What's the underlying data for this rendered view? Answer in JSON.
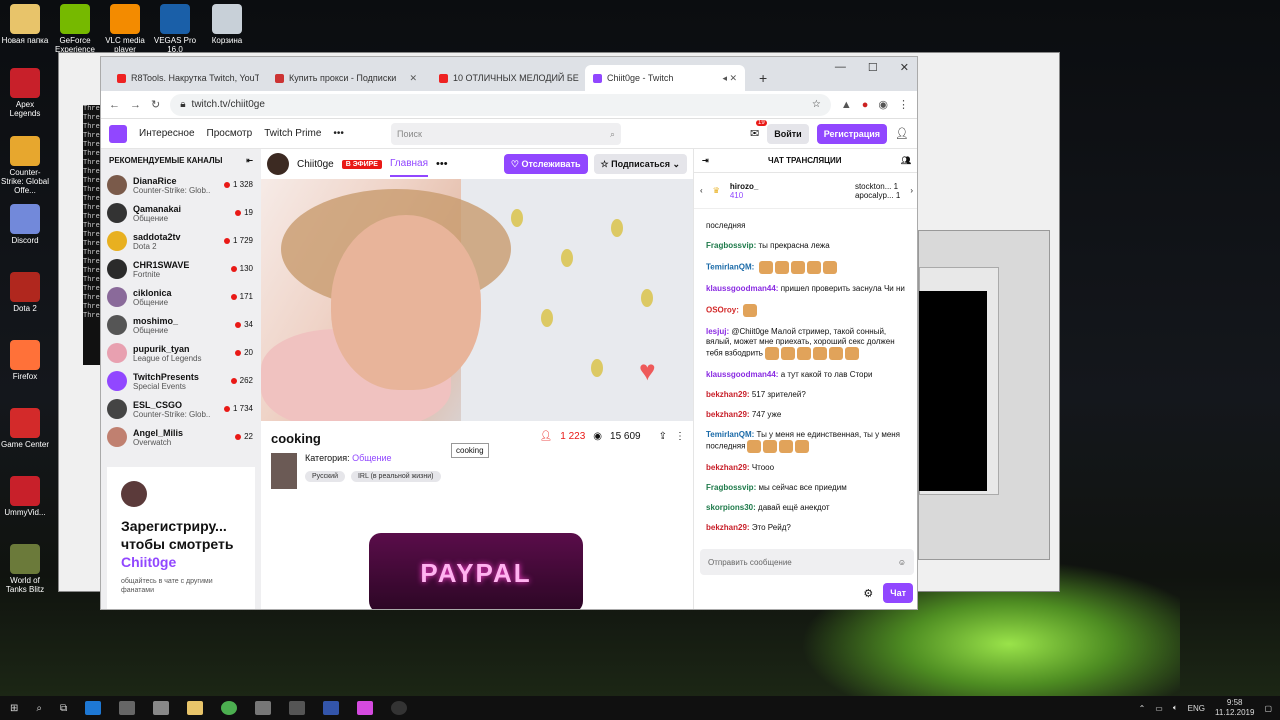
{
  "desktop": {
    "icons": [
      {
        "label": "Новая папка",
        "color": "#e8c46a"
      },
      {
        "label": "GeForce Experience",
        "color": "#76b900"
      },
      {
        "label": "VLC media player",
        "color": "#f38b00"
      },
      {
        "label": "VEGAS Pro 16.0",
        "color": "#1a5fa8"
      },
      {
        "label": "Корзина",
        "color": "#c8d0d8"
      },
      {
        "label": "Apex Legends",
        "color": "#c8202a"
      },
      {
        "label": "Counter-Strike: Global Offe...",
        "color": "#e7a72e"
      },
      {
        "label": "Discord",
        "color": "#7289da"
      },
      {
        "label": "Dota 2",
        "color": "#b0271e"
      },
      {
        "label": "Firefox",
        "color": "#ff7139"
      },
      {
        "label": "Game Center",
        "color": "#d32a2a"
      },
      {
        "label": "UmmyVid...",
        "color": "#c8202a"
      },
      {
        "label": "World of Tanks Blitz",
        "color": "#6b7a3a"
      }
    ],
    "console_lines": [
      "Thre",
      "Thre",
      "Thre",
      "Thre",
      "Thre",
      "Thre",
      "Thre",
      "Thre",
      "Thre",
      "Thre",
      "Thre",
      "Thre",
      "Thre",
      "Thre",
      "Thre",
      "Thre",
      "Thre",
      "Thre",
      "Thre",
      "Thre",
      "Thre",
      "Thre",
      "Thre",
      "Thre"
    ]
  },
  "browser": {
    "tabs": [
      {
        "label": "R8Tools. Накрутка Twitch, YouTu",
        "fav_color": "#e22"
      },
      {
        "label": "Купить прокси - Подписки",
        "fav_color": "#c33"
      },
      {
        "label": "10 ОТЛИЧНЫХ МЕЛОДИЙ БЕЗ",
        "fav_color": "#e22"
      },
      {
        "label": "Chiit0ge - Twitch",
        "fav_color": "#9147ff"
      }
    ],
    "new_tab": "+",
    "url": "twitch.tv/chiit0ge"
  },
  "twitch": {
    "nav": {
      "browse1": "Интересное",
      "browse2": "Просмотр",
      "prime": "Twitch Prime",
      "more": "•••",
      "search_placeholder": "Поиск",
      "notif_count": "19",
      "login": "Войти",
      "signup": "Регистрация"
    },
    "sidebar": {
      "title": "РЕКОМЕНДУЕМЫЕ КАНАЛЫ",
      "channels": [
        {
          "name": "DianaRice",
          "game": "Counter-Strike: Glob...",
          "viewers": "1 328",
          "color": "#7a5a4a"
        },
        {
          "name": "Qamanakai",
          "game": "Общение",
          "viewers": "19",
          "color": "#333"
        },
        {
          "name": "saddota2tv",
          "game": "Dota 2",
          "viewers": "1 729",
          "color": "#e8b020"
        },
        {
          "name": "CHR1SWAVE",
          "game": "Fortnite",
          "viewers": "130",
          "color": "#2a2a2a"
        },
        {
          "name": "ciklonica",
          "game": "Общение",
          "viewers": "171",
          "color": "#8a6a9a"
        },
        {
          "name": "moshimo_",
          "game": "Общение",
          "viewers": "34",
          "color": "#555"
        },
        {
          "name": "pupurik_tyan",
          "game": "League of Legends",
          "viewers": "20",
          "color": "#e8a0b0"
        },
        {
          "name": "TwitchPresents",
          "game": "Special Events",
          "viewers": "262",
          "color": "#9147ff"
        },
        {
          "name": "ESL_CSGO",
          "game": "Counter-Strike: Glob...",
          "viewers": "1 734",
          "color": "#444"
        },
        {
          "name": "Angel_Milis",
          "game": "Overwatch",
          "viewers": "22",
          "color": "#c08070"
        }
      ],
      "signup_title": "Зарегистриру... чтобы смотреть",
      "signup_channel": "Chiit0ge",
      "signup_sub": "общайтесь в чате с другими фанатами"
    },
    "channel": {
      "name": "Chiit0ge",
      "live": "В ЭФИРЕ",
      "tab_home": "Главная",
      "more": "•••",
      "follow": "Отслеживать",
      "subscribe": "Подписаться",
      "stream_title": "cooking",
      "viewers": "1 223",
      "total_views": "15 609",
      "tooltip": "cooking",
      "category_label": "Категория:",
      "category": "Общение",
      "tags": [
        "Русский",
        "IRL (в реальной жизни)"
      ],
      "panel_text": "PAYPAL"
    },
    "chat": {
      "title": "ЧАТ ТРАНСЛЯЦИИ",
      "gifters": [
        {
          "name": "hirozo_",
          "amount": "410"
        },
        {
          "name": "stockton...",
          "amount": "1"
        },
        {
          "name": "apocalyp...",
          "amount": "1"
        }
      ],
      "messages": [
        {
          "user": "",
          "text": "последняя",
          "color": "#111",
          "emotes": 0
        },
        {
          "user": "Fragbossvip:",
          "text": "ты прекрасна лежа",
          "color": "#1e7a4a",
          "emotes": 0
        },
        {
          "user": "TemirlanQM:",
          "text": "",
          "color": "#1a6aa8",
          "emotes": 5
        },
        {
          "user": "klaussgoodman44:",
          "text": "пришел проверить заснула Чи ни",
          "color": "#8a2be2",
          "emotes": 0
        },
        {
          "user": "OSOroy:",
          "text": "",
          "color": "#d32a2a",
          "emotes": 1
        },
        {
          "user": "lesjuj:",
          "text": "@Chiit0ge Малой стример, такой сонный, вялый, может мне приехать, хороший секс должен тебя взбодрить",
          "color": "#8a2be2",
          "emotes": 6
        },
        {
          "user": "klaussgoodman44:",
          "text": "а тут какой то лав Стори",
          "color": "#8a2be2",
          "emotes": 0
        },
        {
          "user": "bekzhan29:",
          "text": "517 зрителей?",
          "color": "#c8202a",
          "emotes": 0
        },
        {
          "user": "bekzhan29:",
          "text": "747 уже",
          "color": "#c8202a",
          "emotes": 0
        },
        {
          "user": "TemirlanQM:",
          "text": "Ты у меня не единственная, ты у меня последняя",
          "color": "#1a6aa8",
          "emotes": 4
        },
        {
          "user": "bekzhan29:",
          "text": "Чтооо",
          "color": "#c8202a",
          "emotes": 0
        },
        {
          "user": "Fragbossvip:",
          "text": "мы сейчас все приедим",
          "color": "#1e7a4a",
          "emotes": 0
        },
        {
          "user": "skorpions30:",
          "text": "давай ещё анекдот",
          "color": "#1e7a4a",
          "emotes": 0
        },
        {
          "user": "bekzhan29:",
          "text": "Это Рейд?",
          "color": "#c8202a",
          "emotes": 0
        }
      ],
      "input_placeholder": "Отправить сообщение",
      "send": "Чат"
    }
  },
  "taskbar": {
    "lang": "ENG",
    "time": "9:58",
    "date": "11.12.2019"
  }
}
